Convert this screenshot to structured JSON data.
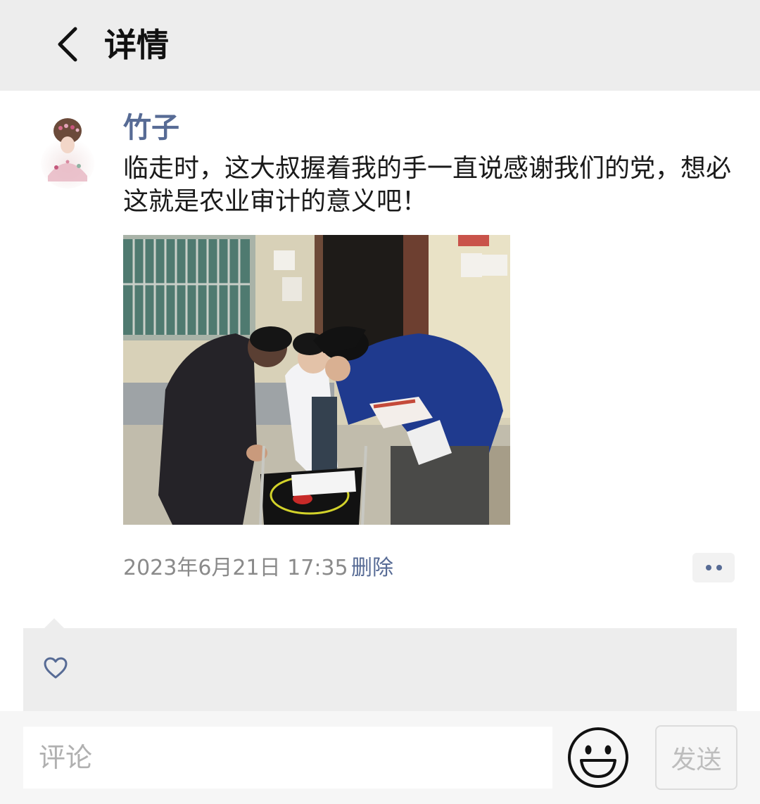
{
  "header": {
    "title": "详情",
    "back_icon": "chevron-left-icon"
  },
  "post": {
    "author": "竹子",
    "text": "临走时，这大叔握着我的手一直说感谢我们的党，想必这就是农业审计的意义吧！",
    "timestamp": "2023年6月21日 17:35",
    "delete_label": "删除",
    "more_icon": "more-dots-icon"
  },
  "likes": {
    "icon": "heart-outline-icon"
  },
  "comment_bar": {
    "placeholder": "评论",
    "emoji_icon": "smiley-icon",
    "send_label": "发送"
  },
  "colors": {
    "link": "#576b95",
    "header_bg": "#ededed",
    "muted": "#8a8a8a"
  }
}
